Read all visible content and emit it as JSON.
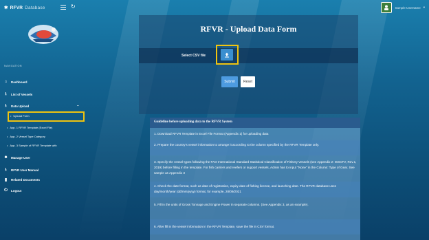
{
  "app": {
    "name": "RFVR",
    "subtitle": "Database"
  },
  "icons": {
    "menu": "menu-icon",
    "refresh": "refresh-icon",
    "avatar": "user-avatar",
    "upload": "upload-icon"
  },
  "user": {
    "name": "Sample Username",
    "caret": "▾"
  },
  "sidebar": {
    "nav_title": "NAVIGATION",
    "items": [
      {
        "label": "Dashboard",
        "icon": "⌂"
      },
      {
        "label": "List of Vessels",
        "icon": "⭳"
      },
      {
        "label": "Data Upload",
        "icon": "⭳",
        "chevron": "−"
      },
      {
        "label": "Manage User",
        "icon": "☻"
      },
      {
        "label": "RFVR User Manual",
        "icon": "⭳"
      },
      {
        "label": "Related Documents",
        "icon": "▮"
      },
      {
        "label": "Logout",
        "icon": "⏻"
      }
    ],
    "sub_items": [
      {
        "label": "Upload Form"
      },
      {
        "label": "App. 1 RFVR Template (Excel File)"
      },
      {
        "label": "App. 2 Vessel Type Category"
      },
      {
        "label": "App. 3 Sample of RFVR Template with"
      }
    ],
    "bullet": "•"
  },
  "main": {
    "title": "RFVR - Upload Data Form",
    "csv_label": "Select CSV file",
    "submit_label": "Submit",
    "reset_label": "Reset"
  },
  "guideline": {
    "heading": "Guideline before uploading data to the RFVR System",
    "items": [
      "1. Download RFVR Template in Excel File Format (Appendix 1) for uploading data",
      "2. Prepare the country's vessel information to arrange it according to the column specified by the RFVR Template only.",
      "3. Specify the vessel types following the FAO International Standard Statistical Classification of Fishery Vessels (see Appendix 2: ISSCFV, Rev.1, 2019) before filling in the template. For fish carriers and reefers or support vessels, Admin has to input \"None\" in the Column: Type of Gear. See sample as Appendix 3",
      "4. Check the date format, such as date of registration, expiry date of fishing license, and launching date. The RFVR database uses day/month/year (dd/mm/yyyy) format, for example, 28/09/2021",
      "5. Fill in the units of Gross Tonnage and Engine Power in separate columns. (See Appendix 3, as an example).",
      "6. After fill in the vessel information in the RFVR Template, save the file in CSV format."
    ]
  }
}
